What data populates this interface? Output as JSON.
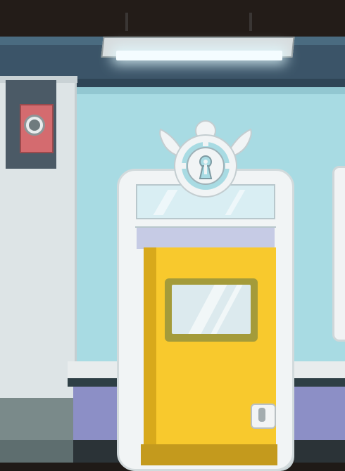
{
  "scene": {
    "type": "game-background",
    "description_items": [
      "ceiling-lamp",
      "wall-socket",
      "emblem",
      "yellow-door",
      "door-window",
      "door-handle"
    ]
  },
  "colors": {
    "wall": "#a8dbe3",
    "door": "#f8c92d",
    "trim": "#f1f4f5",
    "wainscot": "#8c8fc6",
    "socket_plate": "#d46b6f",
    "ceiling": "#231c18"
  },
  "icons": {
    "emblem": "winged-key-emblem-icon",
    "lamp": "ceiling-lamp-icon",
    "socket": "wall-socket-icon",
    "handle": "door-handle-icon"
  }
}
